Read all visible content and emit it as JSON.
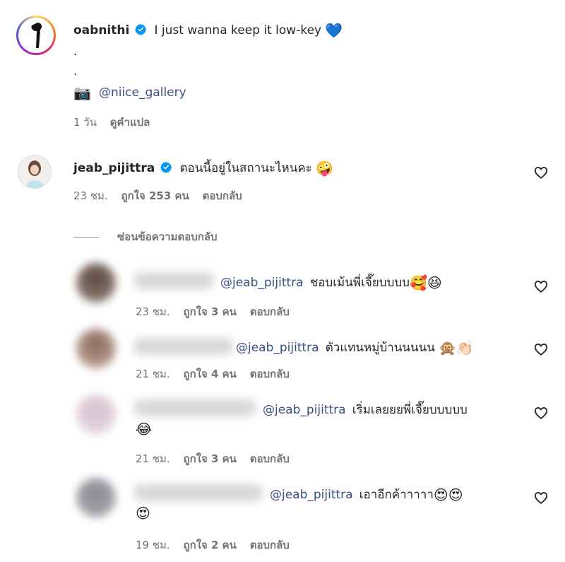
{
  "post": {
    "username": "oabnithi",
    "caption": "I just wanna keep it low-key",
    "caption_emoji": "💙",
    "dot1": ".",
    "dot2": ".",
    "camera_emoji": "📷",
    "credit": "@niice_gallery",
    "time": "1 วัน",
    "translate": "ดูคำแปล"
  },
  "comment": {
    "username": "jeab_pijittra",
    "text": "ตอนนี้อยู่ในสถานะไหนคะ",
    "emoji": "🤪",
    "time": "23 ชม.",
    "likes": "ถูกใจ 253 คน",
    "reply": "ตอบกลับ",
    "hide_replies": "ซ่อนข้อความตอบกลับ"
  },
  "replies": [
    {
      "mention": "@jeab_pijittra",
      "text": "ชอบเม้นพี่เจี๊ยบบบบ",
      "emoji": "🥰😆",
      "time": "23 ชม.",
      "likes": "ถูกใจ 3 คน",
      "reply": "ตอบกลับ"
    },
    {
      "mention": "@jeab_pijittra",
      "text": "ตัวแทนหมู่บ้านนนนน",
      "emoji": "🙊👏🏻",
      "time": "21 ชม.",
      "likes": "ถูกใจ 4 คน",
      "reply": "ตอบกลับ"
    },
    {
      "mention": "@jeab_pijittra",
      "text": "เริ่มเลยยยพี่เจี๊ยบบบบบ",
      "emoji": "😂",
      "time": "21 ชม.",
      "likes": "ถูกใจ 3 คน",
      "reply": "ตอบกลับ"
    },
    {
      "mention": "@jeab_pijittra",
      "text": "เอาอีกค้าาาาา",
      "emoji": "😍😍",
      "emoji2": "😍",
      "time": "19 ชม.",
      "likes": "ถูกใจ 2 คน",
      "reply": "ตอบกลับ"
    }
  ],
  "colors": {
    "verified": "#0095f6",
    "mention": "#385185",
    "meta": "#737373"
  },
  "icons": {
    "verified": "verified-badge-icon",
    "like": "heart-outline-icon"
  }
}
